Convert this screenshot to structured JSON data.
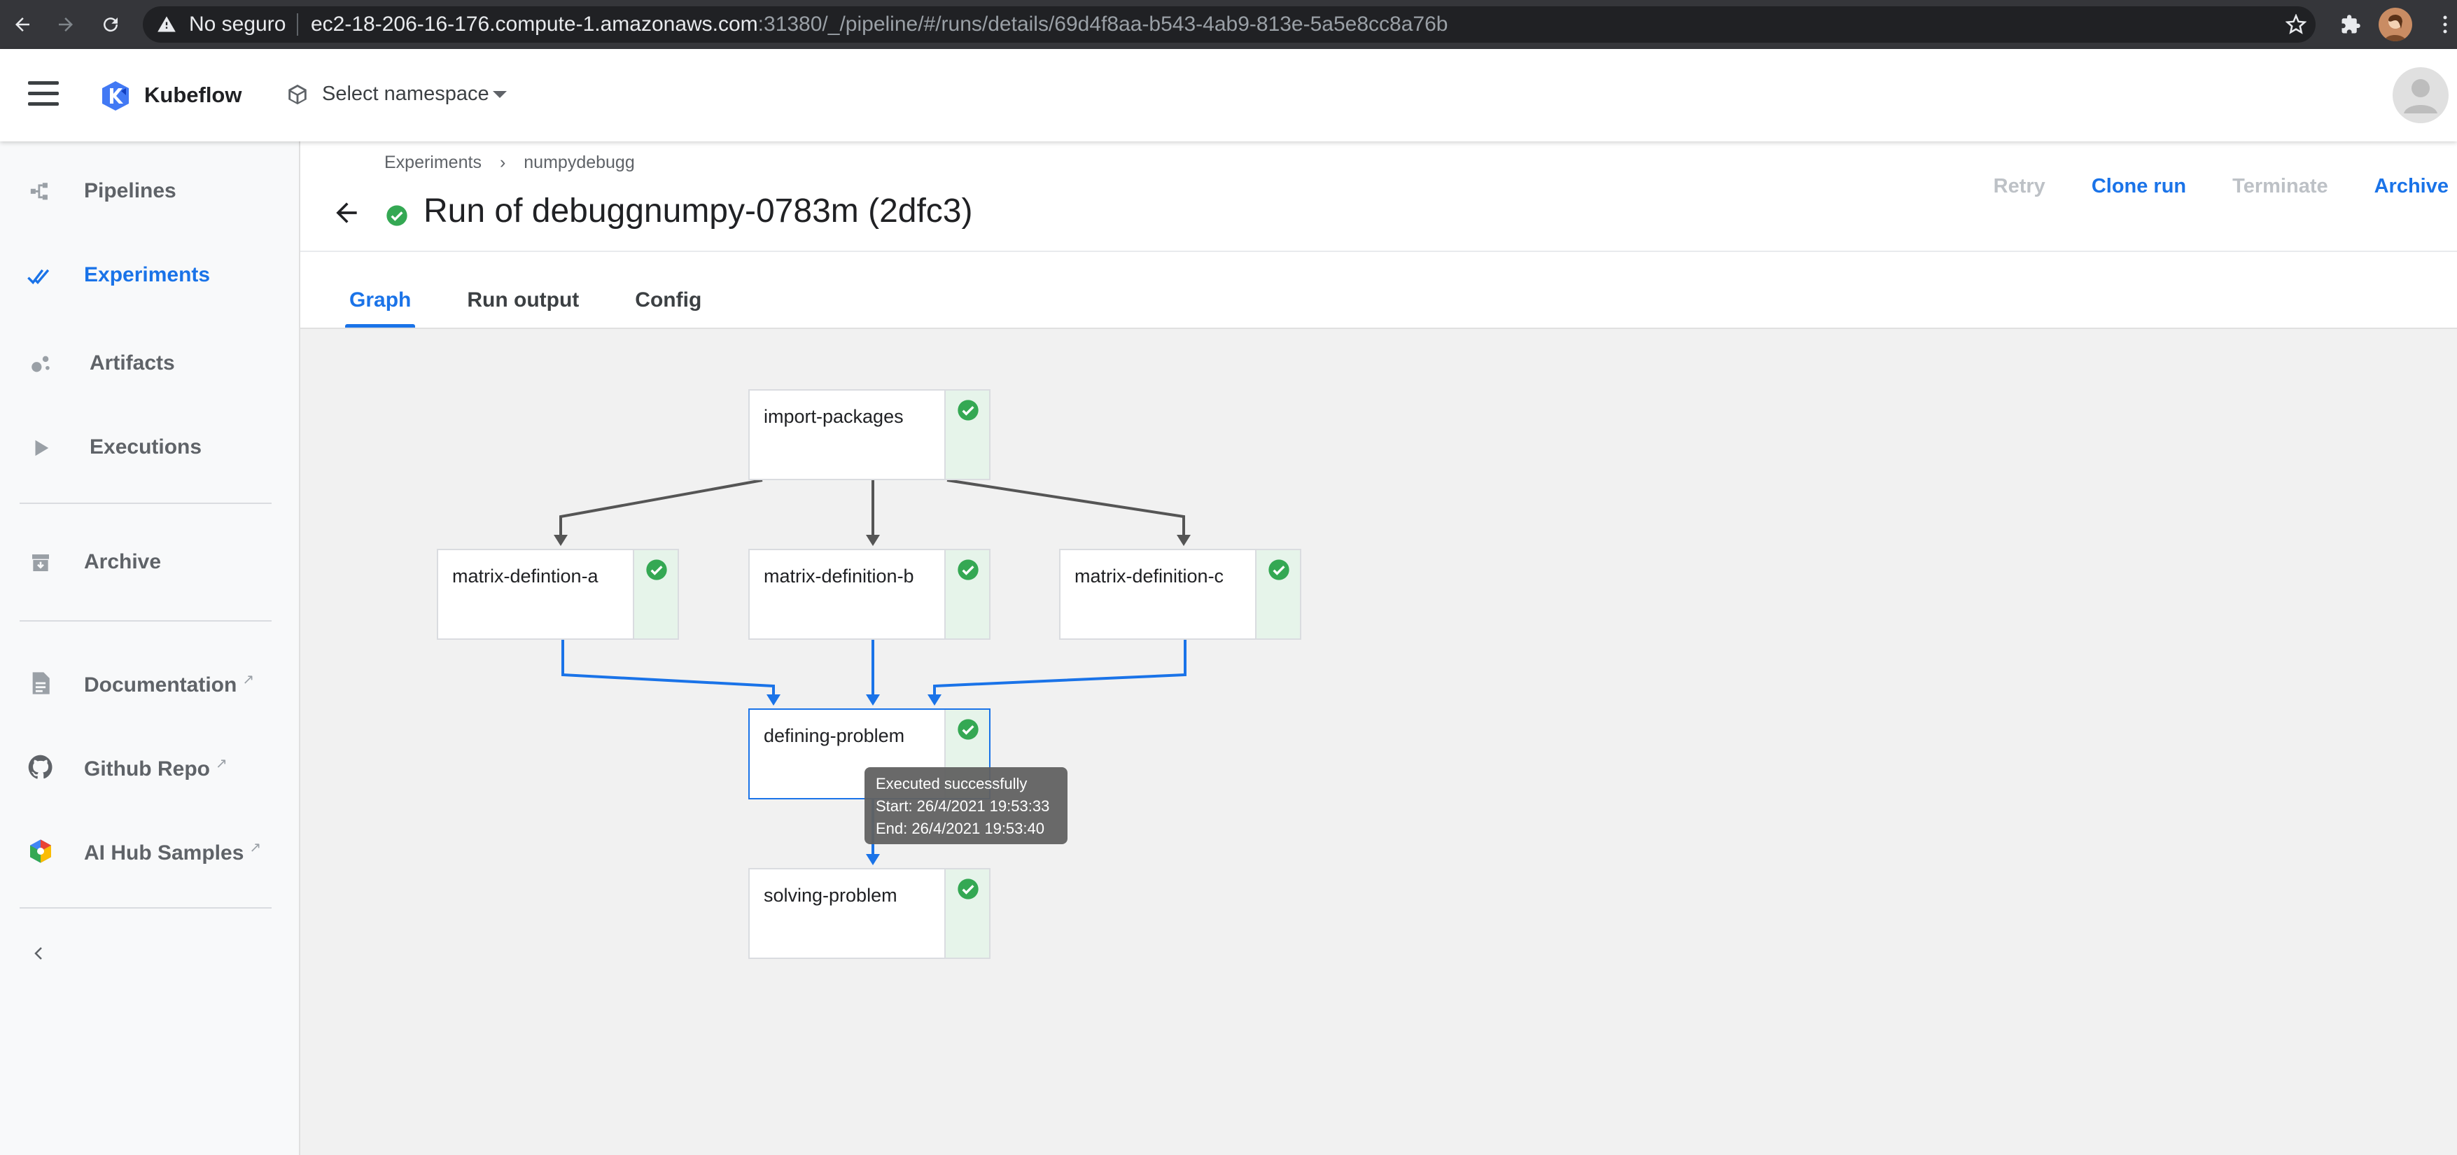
{
  "browser": {
    "security_label": "No seguro",
    "url_host": "ec2-18-206-16-176.compute-1.amazonaws.com",
    "url_path": ":31380/_/pipeline/#/runs/details/69d4f8aa-b543-4ab9-813e-5a5e8cc8a76b"
  },
  "header": {
    "app_name": "Kubeflow",
    "namespace_label": "Select namespace"
  },
  "sidebar": {
    "items": [
      {
        "label": "Pipelines",
        "icon": "pipelines-icon"
      },
      {
        "label": "Experiments",
        "icon": "experiments-icon",
        "active": true
      },
      {
        "label": "Artifacts",
        "icon": "artifacts-icon"
      },
      {
        "label": "Executions",
        "icon": "executions-icon"
      },
      {
        "label": "Archive",
        "icon": "archive-icon"
      },
      {
        "label": "Documentation",
        "icon": "document-icon",
        "external": true
      },
      {
        "label": "Github Repo",
        "icon": "github-icon",
        "external": true
      },
      {
        "label": "AI Hub Samples",
        "icon": "ai-hub-icon",
        "external": true
      }
    ]
  },
  "breadcrumb": {
    "items": [
      "Experiments",
      "numpydebugg"
    ],
    "separator": "›"
  },
  "run": {
    "title": "Run of debuggnumpy-0783m (2dfc3)",
    "status": "succeeded"
  },
  "actions": {
    "retry": "Retry",
    "clone_run": "Clone run",
    "terminate": "Terminate",
    "archive": "Archive"
  },
  "tabs": [
    "Graph",
    "Run output",
    "Config"
  ],
  "graph": {
    "nodes": [
      {
        "id": "import-packages",
        "label": "import-packages",
        "status": "succeeded"
      },
      {
        "id": "matrix-defintion-a",
        "label": "matrix-defintion-a",
        "status": "succeeded"
      },
      {
        "id": "matrix-definition-b",
        "label": "matrix-definition-b",
        "status": "succeeded"
      },
      {
        "id": "matrix-definition-c",
        "label": "matrix-definition-c",
        "status": "succeeded"
      },
      {
        "id": "defining-problem",
        "label": "defining-problem",
        "status": "succeeded"
      },
      {
        "id": "solving-problem",
        "label": "solving-problem",
        "status": "succeeded"
      }
    ],
    "tooltip": {
      "line1": "Executed successfully",
      "line2": "Start: 26/4/2021 19:53:33",
      "line3": "End: 26/4/2021 19:53:40"
    }
  },
  "colors": {
    "accent": "#1a73e8",
    "success": "#34a853",
    "edge_default": "#555555",
    "edge_selected": "#1a73e8"
  }
}
